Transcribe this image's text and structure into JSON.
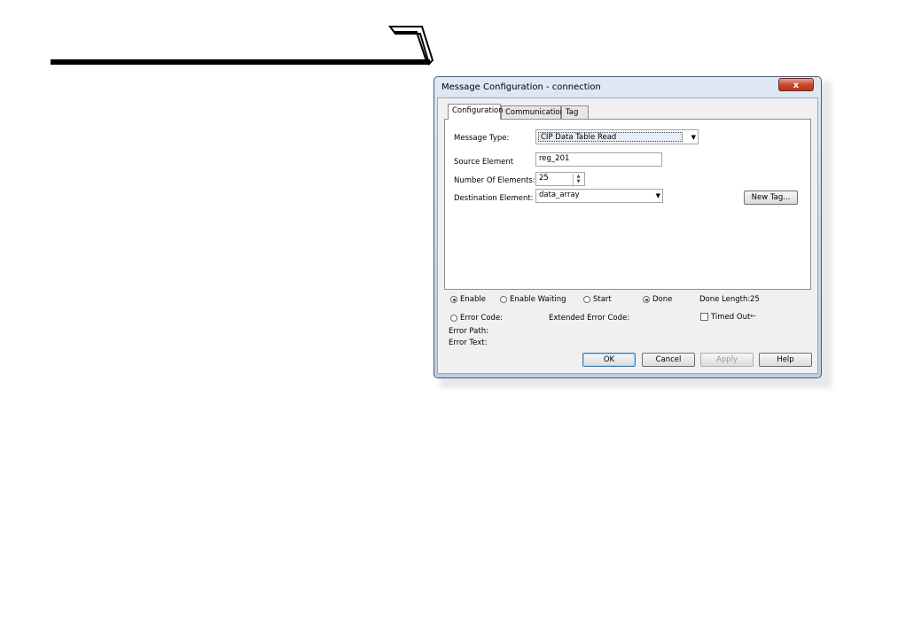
{
  "dialog": {
    "title": "Message Configuration - connection",
    "close_label": "x"
  },
  "tabs": [
    {
      "label": "Configuration",
      "active": true
    },
    {
      "label": "Communication",
      "active": false
    },
    {
      "label": "Tag",
      "active": false
    }
  ],
  "config": {
    "message_type_label": "Message Type:",
    "message_type_value": "CIP Data Table Read",
    "source_element_label": "Source Element",
    "source_element_value": "reg_201",
    "num_elements_label": "Number Of Elements:",
    "num_elements_value": "25",
    "destination_label": "Destination Element:",
    "destination_value": "data_array",
    "new_tag_label": "New Tag..."
  },
  "status": {
    "enable_label": "Enable",
    "enable_waiting_label": "Enable Waiting",
    "start_label": "Start",
    "done_label": "Done",
    "done_length_label": "Done Length:",
    "done_length_value": "25",
    "error_code_label": "Error Code:",
    "extended_error_label": "Extended Error Code:",
    "timed_out_label": "Timed Out",
    "timed_out_arrow": "←",
    "error_path_label": "Error Path:",
    "error_text_label": "Error Text:"
  },
  "buttons": {
    "ok": "OK",
    "cancel": "Cancel",
    "apply": "Apply",
    "help": "Help"
  }
}
